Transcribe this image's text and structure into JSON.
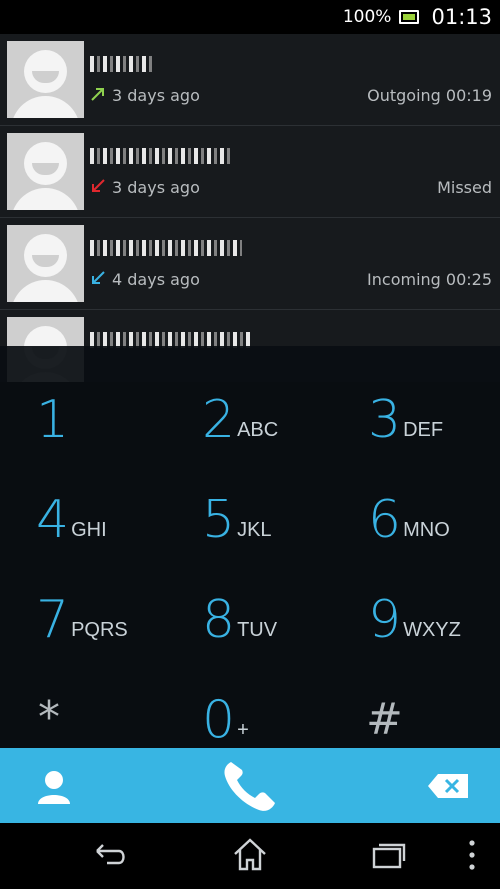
{
  "status_bar": {
    "battery_percent": "100%",
    "time": "01:13",
    "battery_icon": "battery-charging-icon",
    "battery_color": "#9bd23a"
  },
  "call_log": [
    {
      "time_ago": "3 days ago",
      "type_label": "Outgoing 00:19",
      "direction": "outgoing",
      "arrow_color": "#8fd14f",
      "name_width": 64
    },
    {
      "time_ago": "3 days ago",
      "type_label": "Missed",
      "direction": "missed",
      "arrow_color": "#e0282e",
      "name_width": 140
    },
    {
      "time_ago": "4 days ago",
      "type_label": "Incoming 00:25",
      "direction": "incoming",
      "arrow_color": "#39b2e3",
      "name_width": 152
    }
  ],
  "dialpad": {
    "keys": [
      {
        "digit": "1",
        "letters": ""
      },
      {
        "digit": "2",
        "letters": "ABC"
      },
      {
        "digit": "3",
        "letters": "DEF"
      },
      {
        "digit": "4",
        "letters": "GHI"
      },
      {
        "digit": "5",
        "letters": "JKL"
      },
      {
        "digit": "6",
        "letters": "MNO"
      },
      {
        "digit": "7",
        "letters": "PQRS"
      },
      {
        "digit": "8",
        "letters": "TUV"
      },
      {
        "digit": "9",
        "letters": "WXYZ"
      },
      {
        "digit": "*",
        "letters": ""
      },
      {
        "digit": "0",
        "letters": "+"
      },
      {
        "digit": "#",
        "letters": ""
      }
    ],
    "digit_color": "#39b2e3"
  },
  "action_bar": {
    "color": "#38b5e3",
    "contacts_icon": "contacts-icon",
    "call_icon": "phone-icon",
    "delete_icon": "backspace-icon"
  },
  "nav_bar": {
    "back_icon": "back-icon",
    "home_icon": "home-icon",
    "recents_icon": "recent-apps-icon",
    "menu_icon": "overflow-menu-icon"
  }
}
